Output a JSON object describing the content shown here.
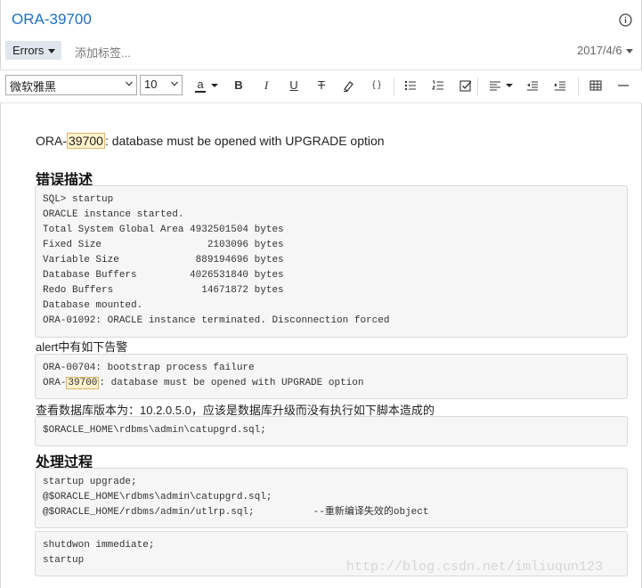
{
  "header": {
    "title": "ORA-39700"
  },
  "tagbar": {
    "notebook": "Errors",
    "add_tag_placeholder": "添加标签...",
    "date": "2017/4/6"
  },
  "toolbar": {
    "font": "微软雅黑",
    "size": "10",
    "color_letter": "a",
    "bold": "B",
    "italic": "I",
    "underline": "U",
    "strike": "T",
    "code_inline": "{ }"
  },
  "doc": {
    "intro_prefix": "ORA-",
    "intro_highlight": "39700",
    "intro_suffix": ": database must be opened with UPGRADE option",
    "heading_error": "错误描述",
    "code_error": [
      "SQL> startup",
      "ORACLE instance started.",
      "Total System Global Area 4932501504 bytes",
      "Fixed Size                  2103096 bytes",
      "Variable Size             889194696 bytes",
      "Database Buffers         4026531840 bytes",
      "Redo Buffers               14671872 bytes",
      "Database mounted.",
      "ORA-01092: ORACLE instance terminated. Disconnection forced"
    ],
    "alert_label": "alert中有如下告警",
    "alert_line1": "ORA-00704: bootstrap process failure",
    "alert_line2_prefix": "ORA-",
    "alert_line2_highlight": "39700",
    "alert_line2_suffix": ": database must be opened with UPGRADE option",
    "version_note": "查看数据库版本为：10.2.0.5.0，应该是数据库升级而没有执行如下脚本造成的",
    "code_catupgrd": "$ORACLE_HOME\\rdbms\\admin\\catupgrd.sql;",
    "heading_fix": "处理过程",
    "code_fix": [
      "startup upgrade;",
      "@$ORACLE_HOME\\rdbms\\admin\\catupgrd.sql;",
      "@$ORACLE_HOME/rdbms/admin/utlrp.sql;          --重新编译失效的object"
    ],
    "code_restart": [
      "shutdwon immediate;",
      "startup"
    ]
  },
  "watermark": "http://blog.csdn.net/imliuqun123"
}
